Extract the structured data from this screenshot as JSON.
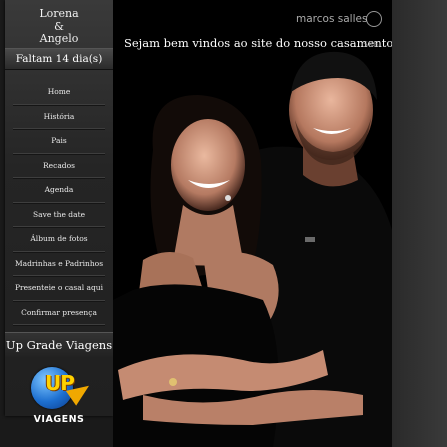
{
  "sidebar": {
    "couple": {
      "line1": "Lorena",
      "line2": "&",
      "line3": "Angelo"
    },
    "countdown": "Faltam 14 dia(s)",
    "menu": [
      {
        "label": "Home",
        "name": "nav-home"
      },
      {
        "label": "História",
        "name": "nav-historia"
      },
      {
        "label": "Pais",
        "name": "nav-pais"
      },
      {
        "label": "Recados",
        "name": "nav-recados"
      },
      {
        "label": "Agenda",
        "name": "nav-agenda"
      },
      {
        "label": "Save the date",
        "name": "nav-save-the-date"
      },
      {
        "label": "Álbum de fotos",
        "name": "nav-album-de-fotos"
      },
      {
        "label": "Madrinhas e Padrinhos",
        "name": "nav-madrinhas-e-padrinhos"
      },
      {
        "label": "Presenteie o casal aqui",
        "name": "nav-presenteie-o-casal"
      },
      {
        "label": "Confirmar presença",
        "name": "nav-confirmar-presenca"
      }
    ],
    "promo": {
      "title": "Up Grade Viagens",
      "logo_word": "UP",
      "logo_text": "VIAGENS"
    }
  },
  "main": {
    "welcome": "Sejam bem vindos ao site do nosso casamento!",
    "watermark": "marcos salles",
    "watermark_sub": "SKB"
  }
}
